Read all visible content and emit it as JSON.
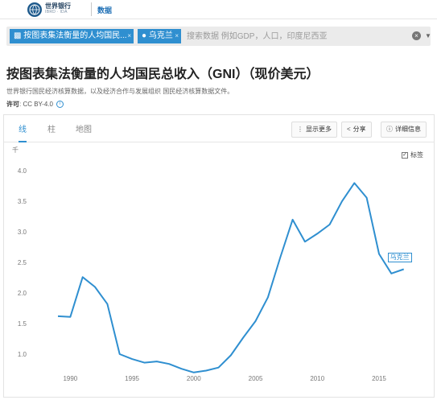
{
  "header": {
    "logo_title": "世界银行",
    "logo_subtitle": "IBRD · IDA",
    "nav_link": "数据"
  },
  "search": {
    "indicator_chip": "按图表集法衡量的人均国民...",
    "country_chip": "乌克兰",
    "placeholder": "搜索数据 例如GDP，人口，印度尼西亚"
  },
  "page": {
    "title": "按图表集法衡量的人均国民总收入（GNI）（现价美元）",
    "source": "世界银行国民经济核算数据，以及经济合作与发展组织 国民经济核算数据文件。",
    "license_label": "许可",
    "license_value": ": CC BY-4.0"
  },
  "tabs": [
    {
      "label": "线"
    },
    {
      "label": "柱"
    },
    {
      "label": "地图"
    }
  ],
  "actions": {
    "more": "显示更多",
    "share": "分享",
    "details": "详细信息"
  },
  "label_toggle": "标签",
  "colors": {
    "accent": "#2f8fd0",
    "line": "#2f8fd0"
  },
  "chart_data": {
    "type": "line",
    "yunit": "千",
    "x_ticks": [
      1990,
      1995,
      2000,
      2005,
      2010,
      2015
    ],
    "ylim": [
      0.75,
      4.2
    ],
    "y_ticks": [
      1.0,
      1.5,
      2.0,
      2.5,
      3.0,
      3.5,
      4.0
    ],
    "y_tick_labels": [
      "1.0",
      "1.5",
      "2.0",
      "2.5",
      "3.0",
      "3.5",
      "4.0"
    ],
    "grid": false,
    "series": [
      {
        "name": "乌克兰",
        "x": [
          1989,
          1990,
          1991,
          1992,
          1993,
          1994,
          1995,
          1996,
          1997,
          1998,
          1999,
          2000,
          2001,
          2002,
          2003,
          2004,
          2005,
          2006,
          2007,
          2008,
          2009,
          2010,
          2011,
          2012,
          2013,
          2014,
          2015,
          2016,
          2017
        ],
        "y": [
          1.62,
          1.61,
          2.26,
          2.1,
          1.82,
          1.0,
          0.92,
          0.86,
          0.88,
          0.84,
          0.76,
          0.7,
          0.73,
          0.78,
          0.98,
          1.27,
          1.54,
          1.93,
          2.58,
          3.2,
          2.84,
          2.97,
          3.12,
          3.5,
          3.8,
          3.56,
          2.64,
          2.32,
          2.39
        ]
      }
    ]
  }
}
